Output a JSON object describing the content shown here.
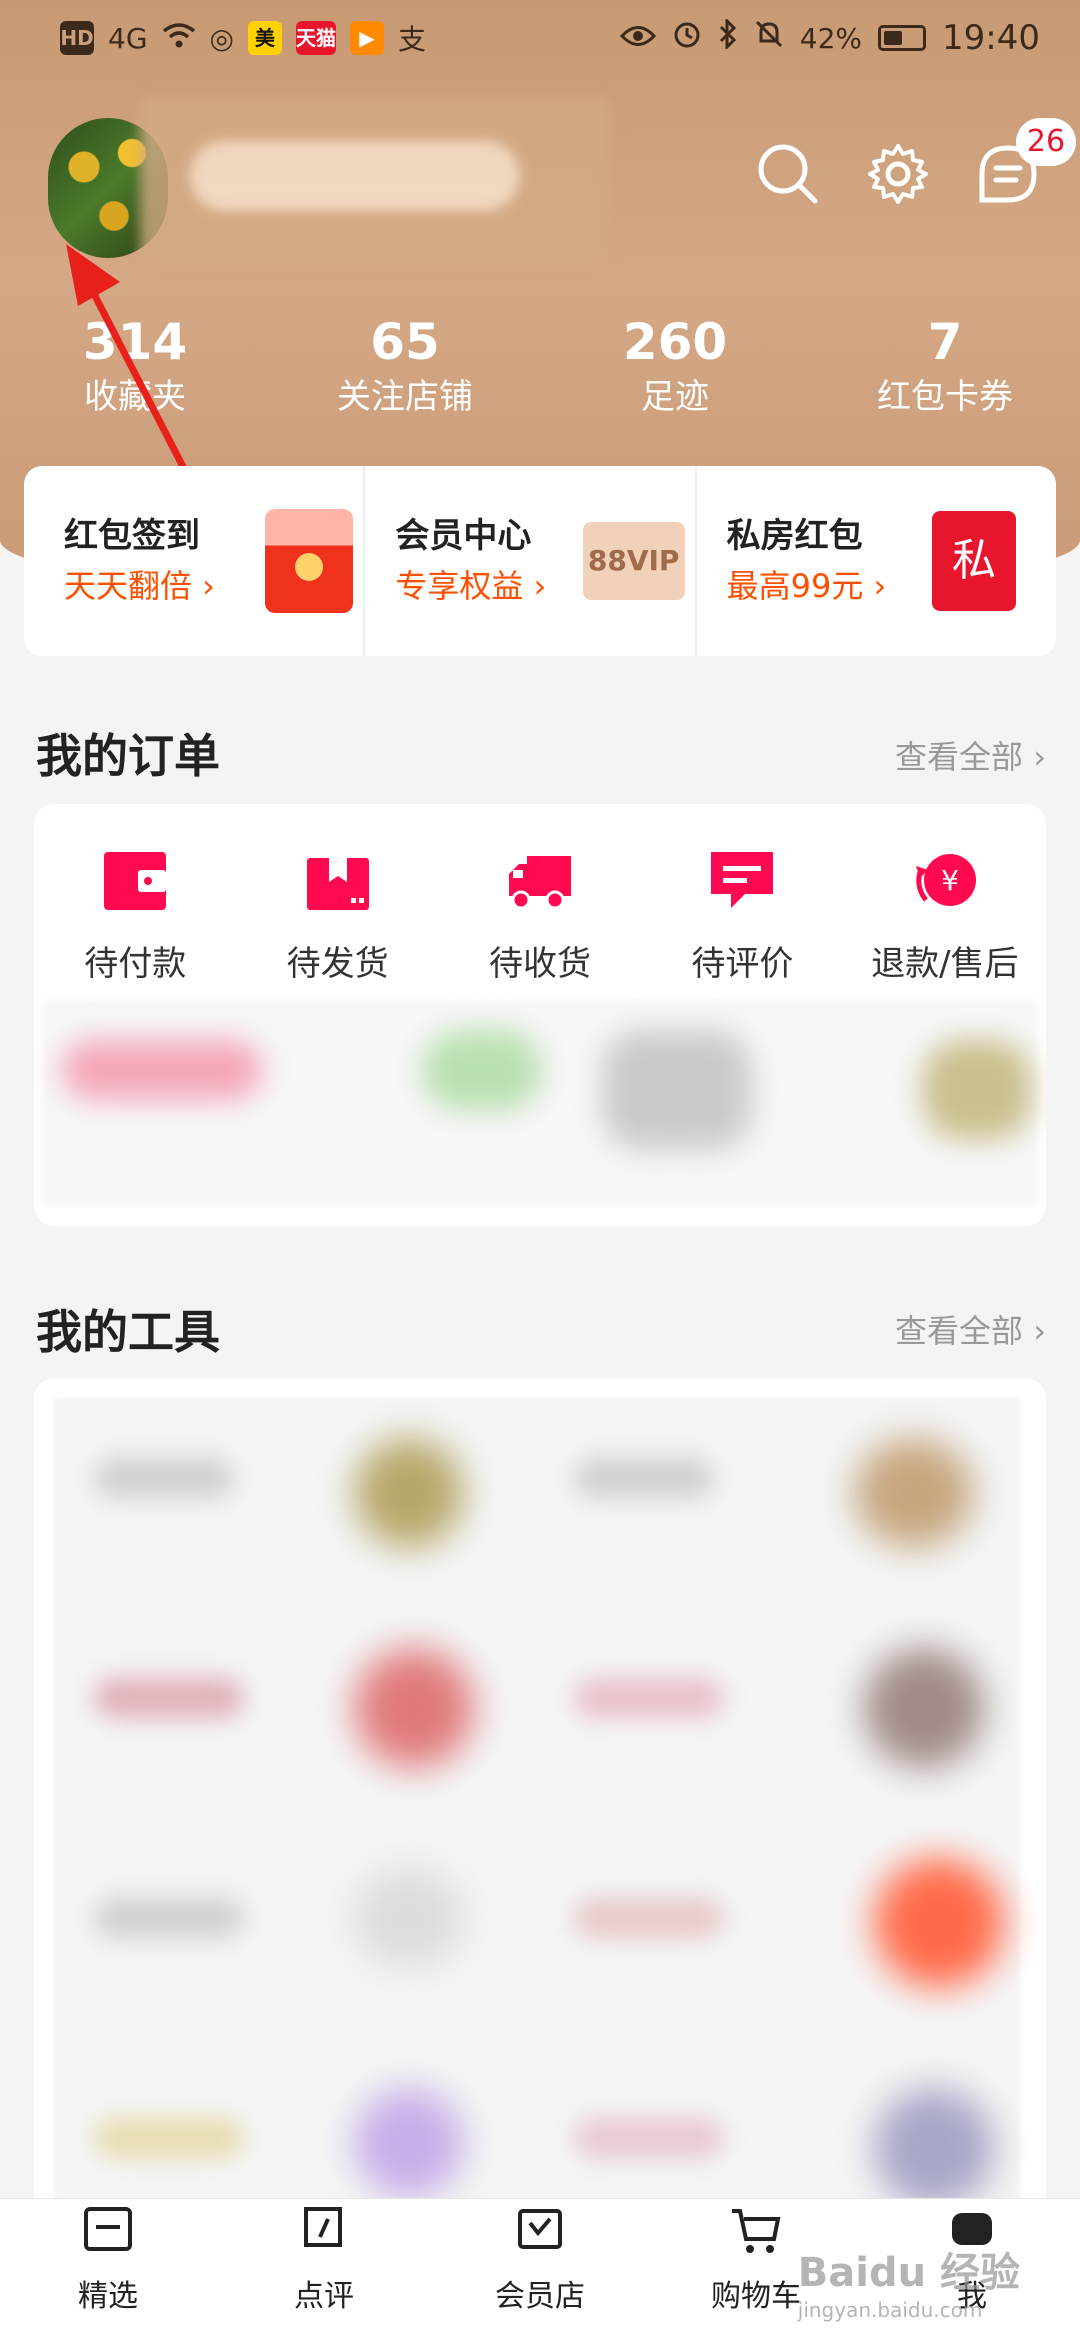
{
  "status_bar": {
    "left_badges": [
      "HD",
      "4G",
      "美",
      "天猫",
      "▶",
      "支"
    ],
    "battery": "42%",
    "time": "19:40"
  },
  "header": {
    "message_badge": "26"
  },
  "stats": [
    {
      "value": "314",
      "label": "收藏夹"
    },
    {
      "value": "65",
      "label": "关注店铺"
    },
    {
      "value": "260",
      "label": "足迹"
    },
    {
      "value": "7",
      "label": "红包卡券"
    }
  ],
  "promo": [
    {
      "title": "红包签到",
      "subtitle": "天天翻倍 ›",
      "image": "red-packet"
    },
    {
      "title": "会员中心",
      "subtitle": "专享权益 ›",
      "image_text": "88VIP"
    },
    {
      "title": "私房红包",
      "subtitle": "最高99元 ›",
      "image_text": "私"
    }
  ],
  "orders": {
    "title": "我的订单",
    "see_all": "查看全部 ›",
    "items": [
      {
        "label": "待付款",
        "icon": "wallet-icon"
      },
      {
        "label": "待发货",
        "icon": "package-icon"
      },
      {
        "label": "待收货",
        "icon": "truck-icon"
      },
      {
        "label": "待评价",
        "icon": "comment-icon"
      },
      {
        "label": "退款/售后",
        "icon": "refund-icon"
      }
    ]
  },
  "tools": {
    "title": "我的工具",
    "see_all": "查看全部 ›"
  },
  "bottom_nav": [
    {
      "label": "精选"
    },
    {
      "label": "点评"
    },
    {
      "label": "会员店"
    },
    {
      "label": "购物车"
    },
    {
      "label": "我"
    }
  ],
  "watermark": {
    "main": "Baidu 经验",
    "sub": "jingyan.baidu.com"
  },
  "colors": {
    "accent": "#ff5000",
    "brand_red": "#ff0a50",
    "header_bg": "#d5a886"
  }
}
